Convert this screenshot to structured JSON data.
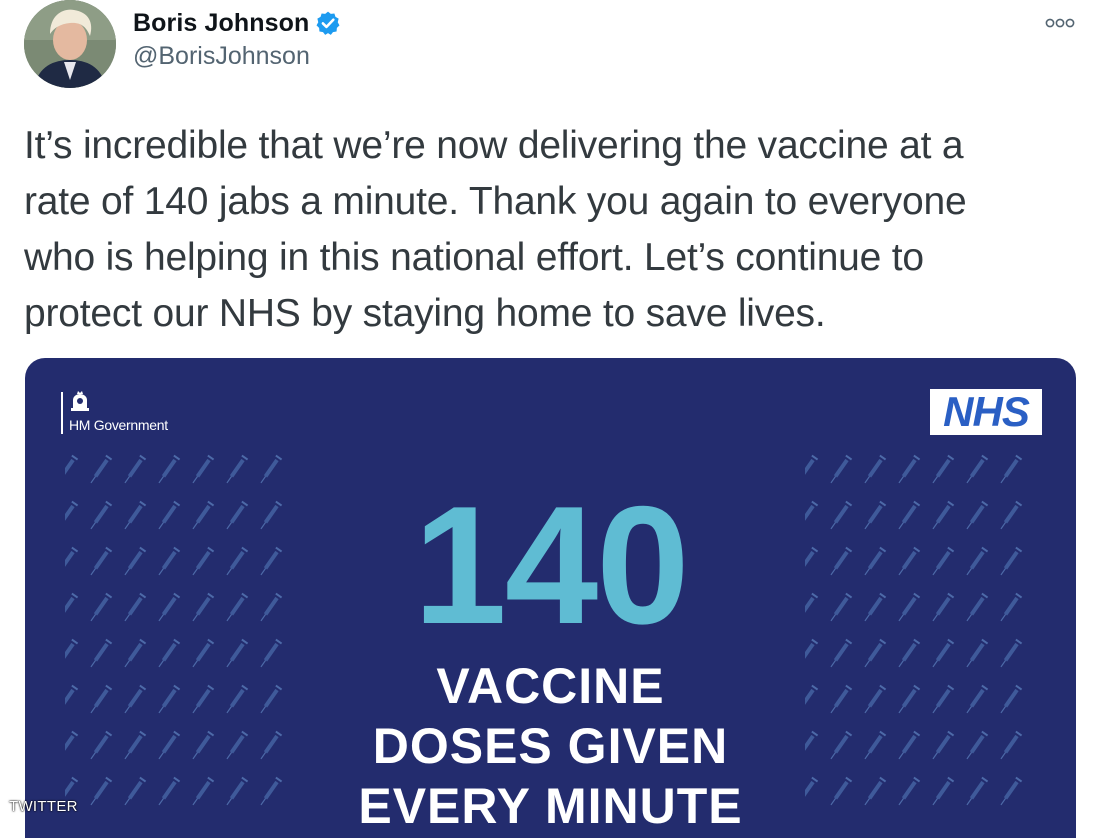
{
  "author": {
    "display_name": "Boris Johnson",
    "handle": "@BorisJohnson",
    "verified": true,
    "avatar_icon": "profile-photo"
  },
  "menu": {
    "icon": "more-options-icon"
  },
  "tweet": {
    "text": "It’s incredible that we’re now delivering the vaccine at a\nrate of 140 jabs a minute. Thank you again to everyone\nwho is helping in this national effort. Let’s continue to\nprotect our NHS by staying home to save lives."
  },
  "media": {
    "background_color": "#232c6e",
    "accent_color": "#5fbcd3",
    "gov_logo_text": "HM Government",
    "nhs_logo_text": "NHS",
    "big_number": "140",
    "caption_lines": [
      "VACCINE",
      "DOSES GIVEN",
      "EVERY MINUTE"
    ],
    "pattern_icon": "syringe-icon"
  },
  "watermark": {
    "text": "TWITTER"
  }
}
